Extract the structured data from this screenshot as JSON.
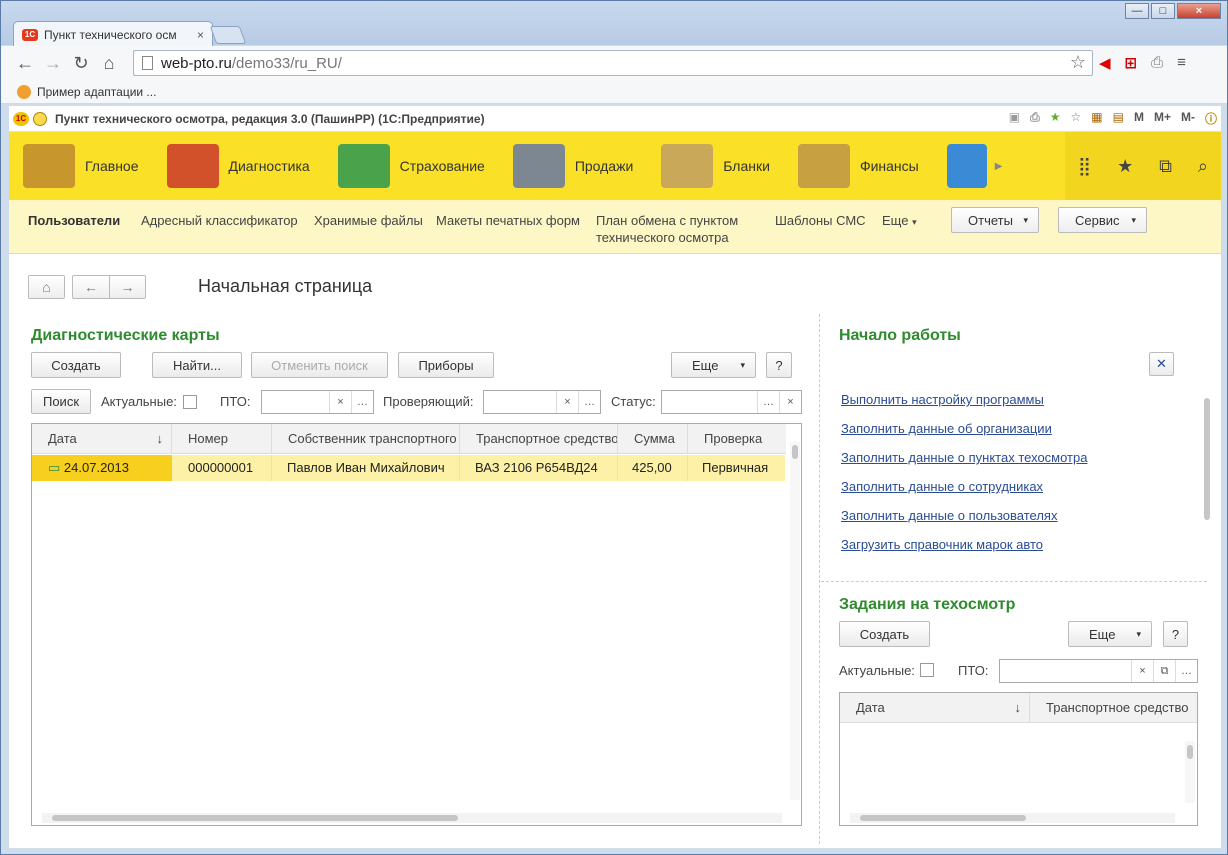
{
  "browser": {
    "tab_title": "Пункт технического осм",
    "tab_close": "×",
    "url_host": "web-pto.ru",
    "url_path": "/demo33/ru_RU/",
    "bookmark": "Пример адаптации ...",
    "window_buttons": [
      "—",
      "□",
      "×"
    ]
  },
  "app": {
    "title": "Пункт технического осмотра, редакция 3.0 (ПашинРР) (1С:Предприятие)",
    "header_tools": [
      "M",
      "M+",
      "M-"
    ]
  },
  "sections": [
    {
      "label": "Главное",
      "color": "#c7962c"
    },
    {
      "label": "Диагностика",
      "color": "#d2502a"
    },
    {
      "label": "Страхование",
      "color": "#4aa34a"
    },
    {
      "label": "Продажи",
      "color": "#7c8792"
    },
    {
      "label": "Бланки",
      "color": "#c9a85a"
    },
    {
      "label": "Финансы",
      "color": "#c6a041"
    }
  ],
  "functions": {
    "items": [
      "Пользователи",
      "Адресный классификатор",
      "Хранимые файлы",
      "Макеты печатных форм",
      "План обмена с пунктом",
      "технического осмотра",
      "Шаблоны СМС"
    ],
    "more": "Еще",
    "reports": "Отчеты",
    "service": "Сервис"
  },
  "page": {
    "title": "Начальная страница"
  },
  "diag": {
    "title": "Диагностические карты",
    "btn_create": "Создать",
    "btn_find": "Найти...",
    "btn_cancel_search": "Отменить поиск",
    "btn_devices": "Приборы",
    "btn_more": "Еще",
    "btn_help": "?",
    "btn_search": "Поиск",
    "lbl_actual": "Актуальные:",
    "lbl_pto": "ПТО:",
    "lbl_inspector": "Проверяющий:",
    "lbl_status": "Статус:",
    "columns": [
      "Дата",
      "Номер",
      "Собственник транспортного",
      "Транспортное средство",
      "Сумма",
      "Проверка"
    ],
    "sort_arrow": "↓",
    "rows": [
      {
        "date": "24.07.2013",
        "number": "000000001",
        "owner": "Павлов Иван Михайлович",
        "vehicle": "ВАЗ 2106 Р654ВД24",
        "sum": "425,00",
        "check": "Первичная"
      }
    ]
  },
  "start": {
    "title": "Начало работы",
    "links": [
      "Выполнить настройку программы",
      "Заполнить данные об организации",
      "Заполнить данные о пунктах техосмотра",
      "Заполнить данные о сотрудниках",
      "Заполнить данные о пользователях",
      "Загрузить справочник марок авто"
    ]
  },
  "tasks": {
    "title": "Задания на техосмотр",
    "btn_create": "Создать",
    "btn_more": "Еще",
    "btn_help": "?",
    "lbl_actual": "Актуальные:",
    "lbl_pto": "ПТО:",
    "columns": [
      "Дата",
      "Транспортное средство"
    ],
    "sort_arrow": "↓"
  }
}
